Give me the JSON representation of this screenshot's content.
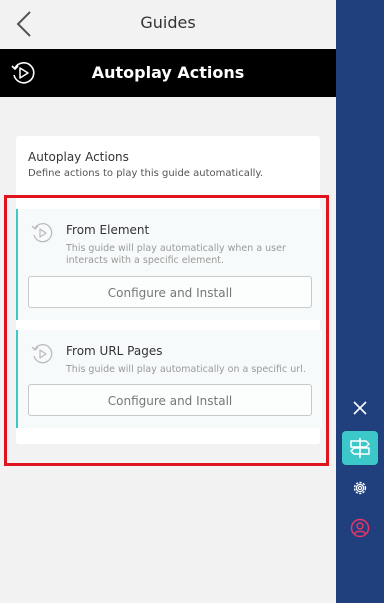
{
  "header": {
    "title": "Guides"
  },
  "titlebar": {
    "title": "Autoplay Actions"
  },
  "card": {
    "title": "Autoplay Actions",
    "description": "Define actions to play this guide automatically."
  },
  "options": [
    {
      "title": "From Element",
      "description": "This guide will play automatically when a user interacts with a specific element.",
      "button": "Configure and Install",
      "icon": "autoplay-icon"
    },
    {
      "title": "From URL Pages",
      "description": "This guide will play automatically on a specific url.",
      "button": "Configure and Install",
      "icon": "autoplay-icon"
    }
  ],
  "sidebar": {
    "items": [
      "close-icon",
      "guides-signpost-icon",
      "gear-icon",
      "user-icon"
    ]
  },
  "colors": {
    "accent": "#3cc8c9",
    "sidebar": "#1f3f7d",
    "highlight": "#e0141e",
    "user_icon": "#e8346a"
  }
}
